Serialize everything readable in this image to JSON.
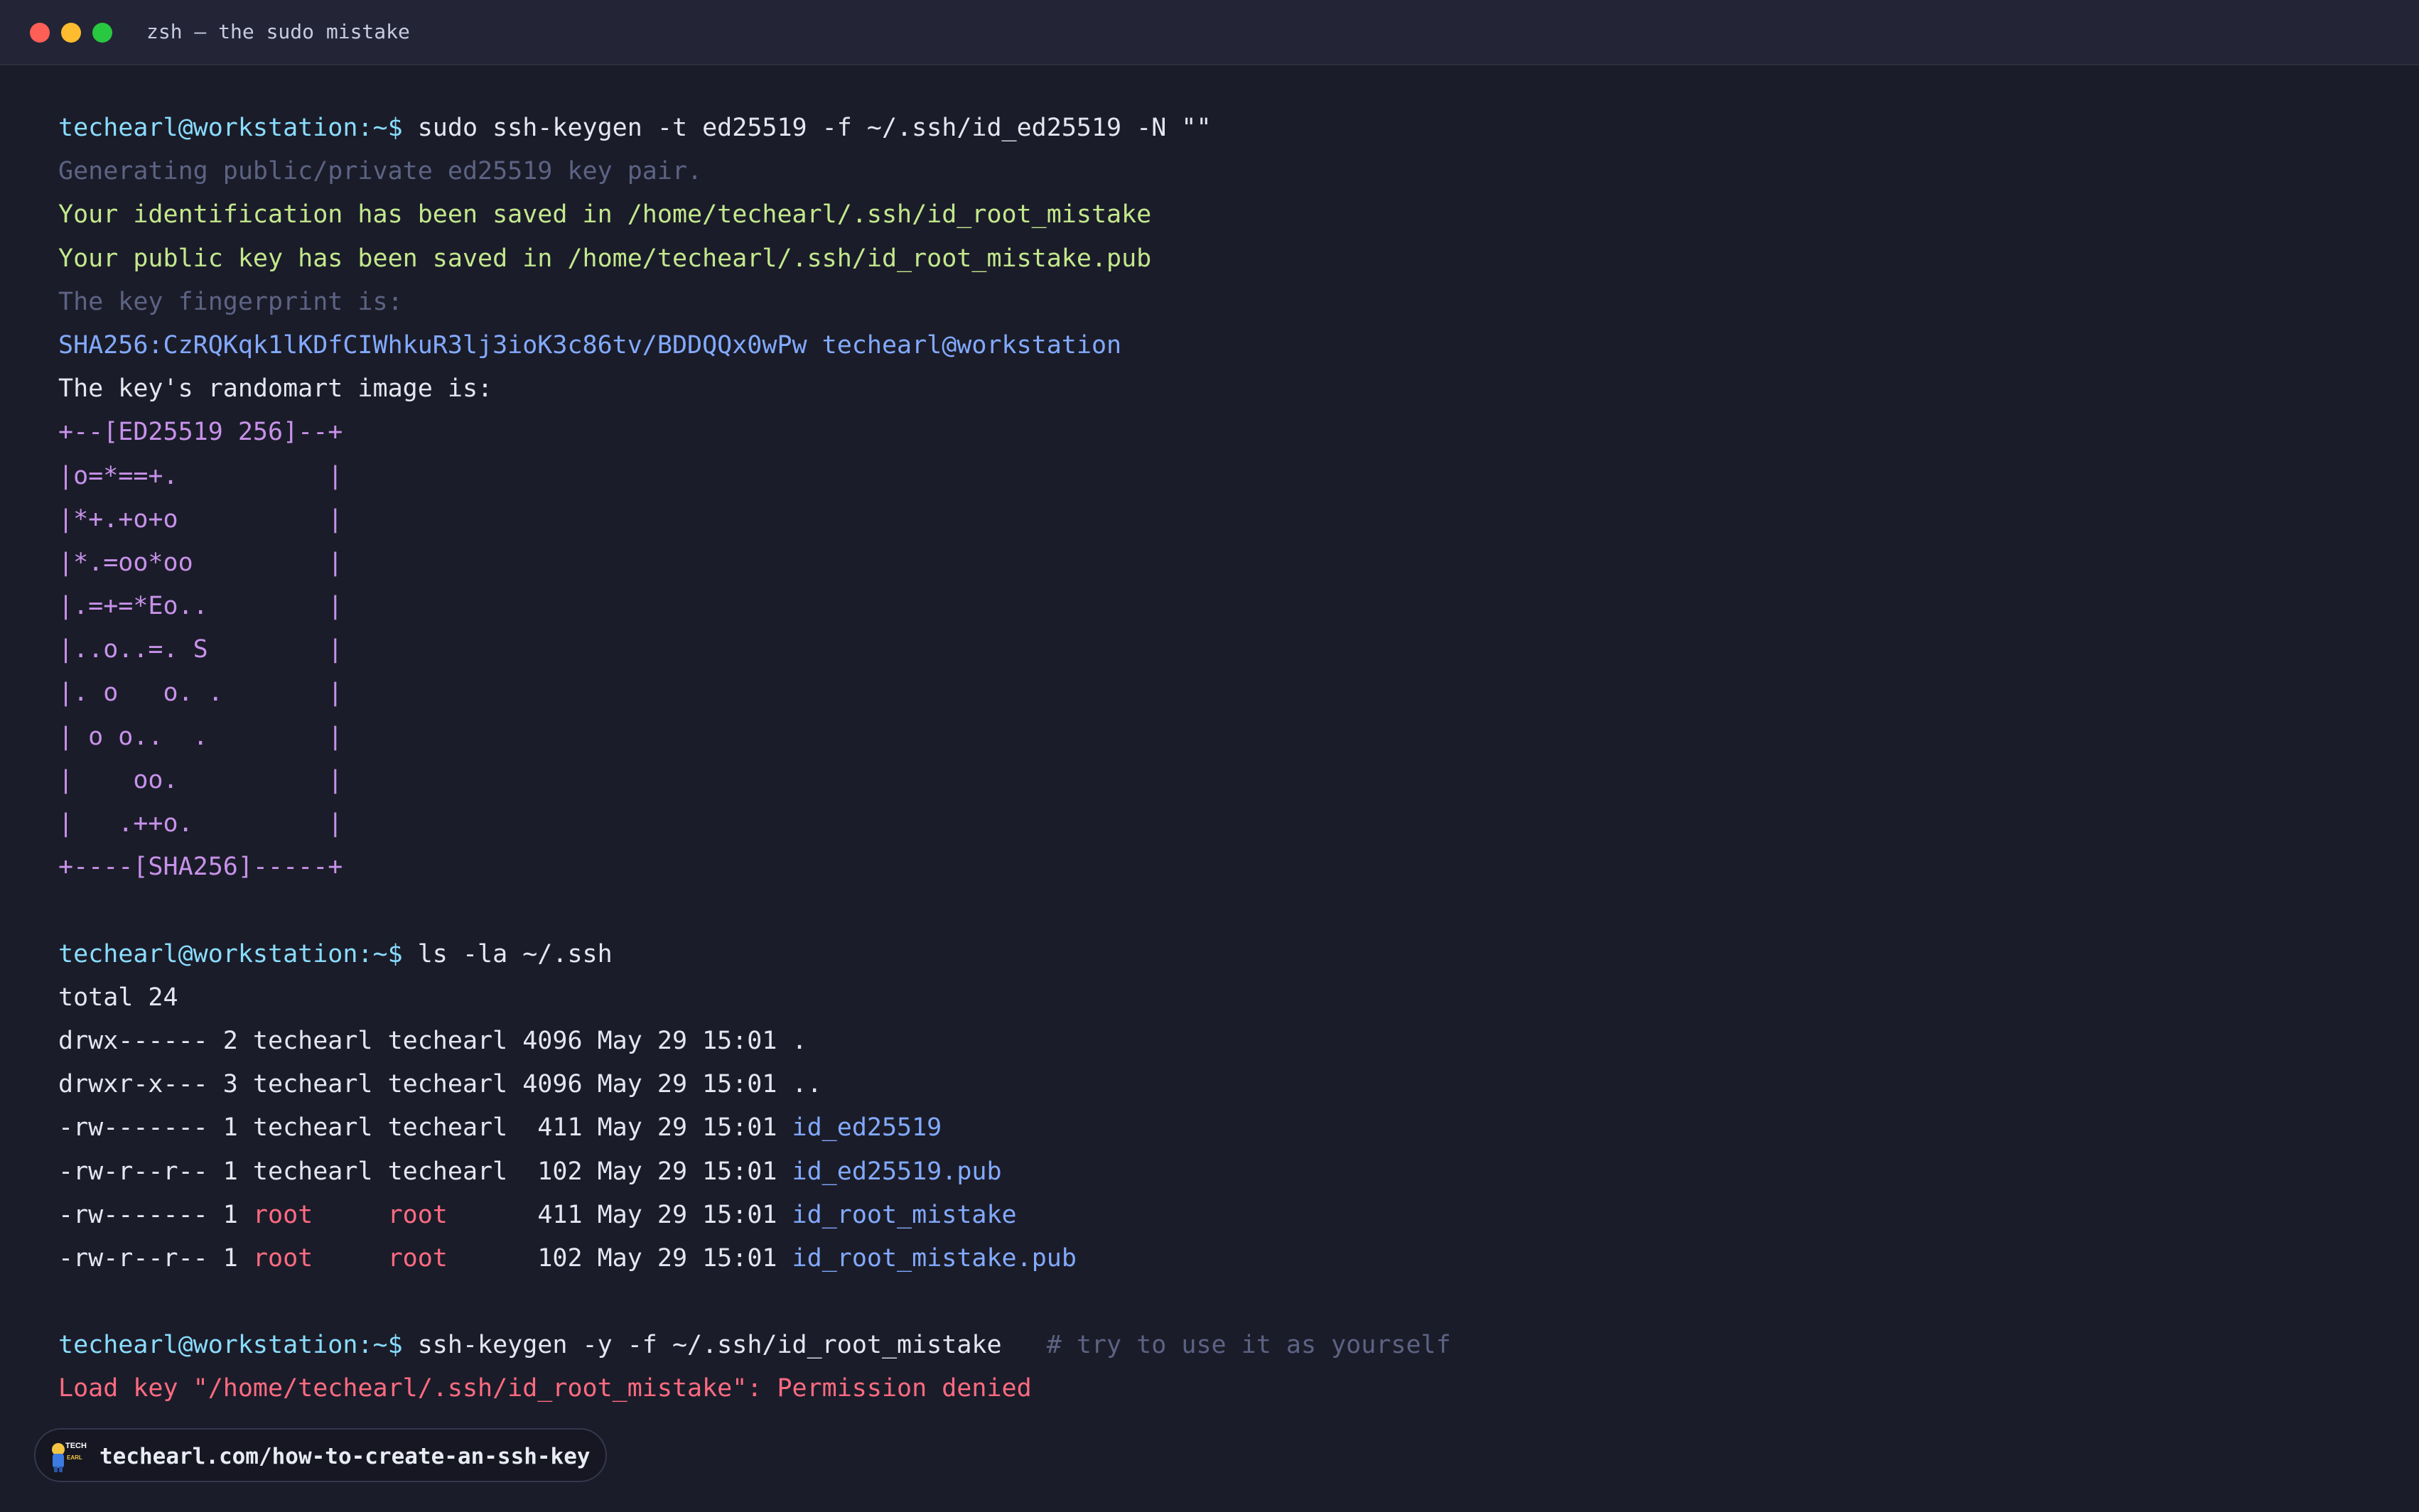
{
  "window": {
    "title": "zsh — the sudo mistake"
  },
  "colors": {
    "background": "#1b1c29",
    "prompt": "#89ddff",
    "dim": "#5c6383",
    "success": "#c3e88d",
    "link": "#82aaff",
    "art": "#c792ea",
    "error": "#ff6b81"
  },
  "terminal": {
    "lines": [
      [
        {
          "t": "techearl@workstation:~$ ",
          "c": "prompt"
        },
        {
          "t": "sudo ssh-keygen -t ed25519 -f ~/.ssh/id_ed25519 -N \"\"",
          "c": "cmd"
        }
      ],
      [
        {
          "t": "Generating public/private ed25519 key pair.",
          "c": "dim"
        }
      ],
      [
        {
          "t": "Your identification has been saved in /home/techearl/.ssh/id_root_mistake",
          "c": "green"
        }
      ],
      [
        {
          "t": "Your public key has been saved in /home/techearl/.ssh/id_root_mistake.pub",
          "c": "green"
        }
      ],
      [
        {
          "t": "The key fingerprint is:",
          "c": "dim"
        }
      ],
      [
        {
          "t": "SHA256:CzRQKqk1lKDfCIWhkuR3lj3ioK3c86tv/BDDQQx0wPw techearl@workstation",
          "c": "blue"
        }
      ],
      [
        {
          "t": "The key's randomart image is:",
          "c": "plain"
        }
      ],
      [
        {
          "t": "+--[ED25519 256]--+",
          "c": "purple"
        }
      ],
      [
        {
          "t": "|o=*==+.          |",
          "c": "purple"
        }
      ],
      [
        {
          "t": "|*+.+o+o          |",
          "c": "purple"
        }
      ],
      [
        {
          "t": "|*.=oo*oo         |",
          "c": "purple"
        }
      ],
      [
        {
          "t": "|.=+=*Eo..        |",
          "c": "purple"
        }
      ],
      [
        {
          "t": "|..o..=. S        |",
          "c": "purple"
        }
      ],
      [
        {
          "t": "|. o   o. .       |",
          "c": "purple"
        }
      ],
      [
        {
          "t": "| o o..  .        |",
          "c": "purple"
        }
      ],
      [
        {
          "t": "|    oo.          |",
          "c": "purple"
        }
      ],
      [
        {
          "t": "|   .++o.         |",
          "c": "purple"
        }
      ],
      [
        {
          "t": "+----[SHA256]-----+",
          "c": "purple"
        }
      ],
      [],
      [
        {
          "t": "techearl@workstation:~$ ",
          "c": "prompt"
        },
        {
          "t": "ls -la ~/.ssh",
          "c": "cmd"
        }
      ],
      [
        {
          "t": "total 24",
          "c": "plain"
        }
      ],
      [
        {
          "t": "drwx------ 2 techearl techearl 4096 May 29 15:01 .",
          "c": "plain"
        }
      ],
      [
        {
          "t": "drwxr-x--- 3 techearl techearl 4096 May 29 15:01 ..",
          "c": "plain"
        }
      ],
      [
        {
          "t": "-rw------- 1 techearl techearl  411 May 29 15:01 ",
          "c": "plain"
        },
        {
          "t": "id_ed25519",
          "c": "blue"
        }
      ],
      [
        {
          "t": "-rw-r--r-- 1 techearl techearl  102 May 29 15:01 ",
          "c": "plain"
        },
        {
          "t": "id_ed25519.pub",
          "c": "blue"
        }
      ],
      [
        {
          "t": "-rw------- 1 ",
          "c": "plain"
        },
        {
          "t": "root",
          "c": "red"
        },
        {
          "t": "     ",
          "c": "plain"
        },
        {
          "t": "root",
          "c": "red"
        },
        {
          "t": "      411 May 29 15:01 ",
          "c": "plain"
        },
        {
          "t": "id_root_mistake",
          "c": "blue"
        }
      ],
      [
        {
          "t": "-rw-r--r-- 1 ",
          "c": "plain"
        },
        {
          "t": "root",
          "c": "red"
        },
        {
          "t": "     ",
          "c": "plain"
        },
        {
          "t": "root",
          "c": "red"
        },
        {
          "t": "      102 May 29 15:01 ",
          "c": "plain"
        },
        {
          "t": "id_root_mistake.pub",
          "c": "blue"
        }
      ],
      [],
      [
        {
          "t": "techearl@workstation:~$ ",
          "c": "prompt"
        },
        {
          "t": "ssh-keygen -y -f ~/.ssh/id_root_mistake   ",
          "c": "cmd"
        },
        {
          "t": "# try to use it as yourself",
          "c": "dim"
        }
      ],
      [
        {
          "t": "Load key \"/home/techearl/.ssh/id_root_mistake\": Permission denied",
          "c": "red"
        }
      ]
    ]
  },
  "badge": {
    "logo_text_top": "TECH",
    "logo_text_bottom": "EARL",
    "url": "techearl.com/how-to-create-an-ssh-key"
  }
}
